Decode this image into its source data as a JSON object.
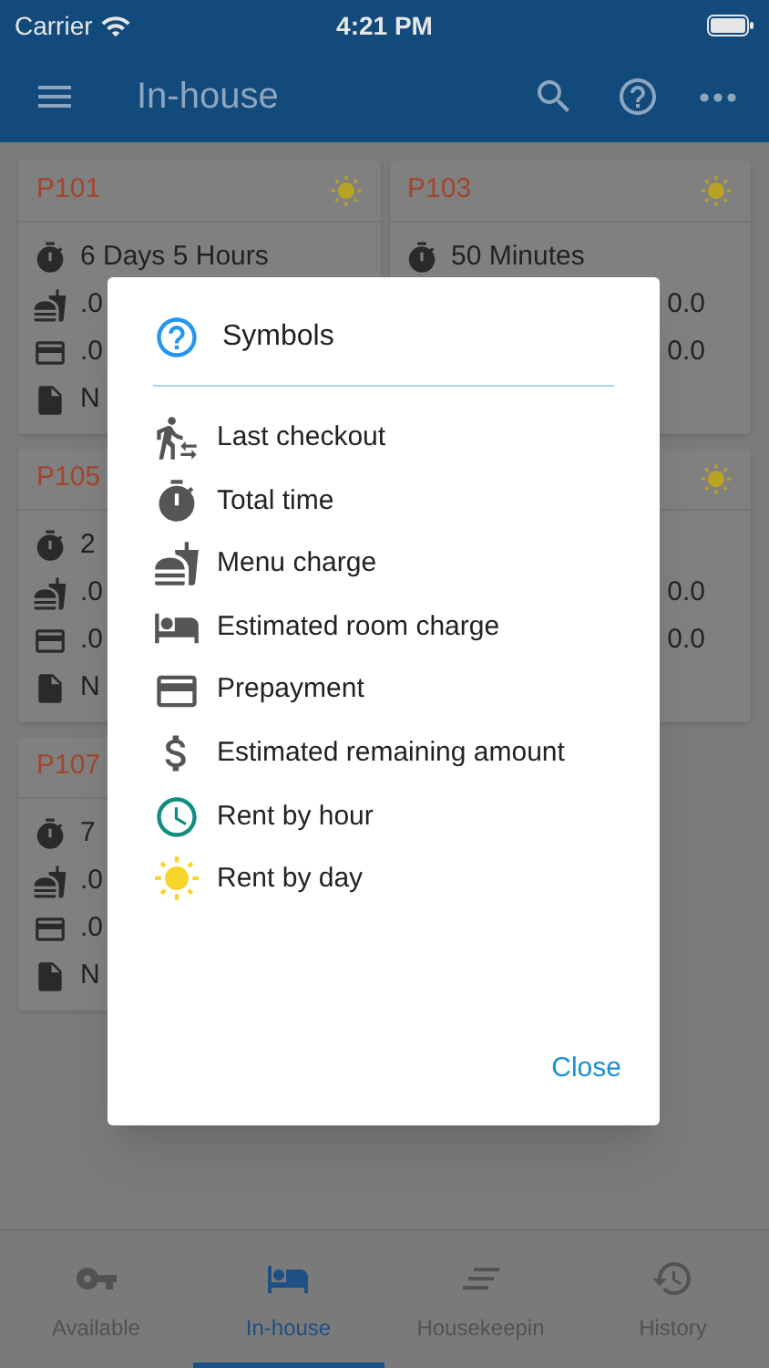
{
  "status_bar": {
    "carrier": "Carrier",
    "time": "4:21 PM"
  },
  "app_bar": {
    "title": "In-house"
  },
  "cards": [
    {
      "room": "P101",
      "rent_by_day": true,
      "rows": [
        {
          "kind": "time",
          "text": "6 Days 5 Hours"
        },
        {
          "kind": "menu",
          "text": ".0"
        },
        {
          "kind": "prepay",
          "text": ".0"
        },
        {
          "kind": "note",
          "text": "N"
        }
      ]
    },
    {
      "room": "P103",
      "rent_by_day": true,
      "rows": [
        {
          "kind": "time",
          "text": "50 Minutes"
        },
        {
          "kind": "amount",
          "text": "0.0"
        },
        {
          "kind": "amount",
          "text": "0.0"
        }
      ]
    },
    {
      "room": "P105",
      "rows": [
        {
          "kind": "time",
          "text": "2"
        },
        {
          "kind": "menu",
          "text": ".0"
        },
        {
          "kind": "prepay",
          "text": ".0"
        },
        {
          "kind": "note",
          "text": "N"
        }
      ]
    },
    {
      "rent_by_day": true,
      "rows": [
        {
          "kind": "blank"
        },
        {
          "kind": "amount",
          "text": "0.0"
        },
        {
          "kind": "amount",
          "text": "0.0"
        }
      ]
    },
    {
      "room": "P107",
      "rows": [
        {
          "kind": "time",
          "text": "7"
        },
        {
          "kind": "menu",
          "text": ".0"
        },
        {
          "kind": "prepay",
          "text": ".0"
        },
        {
          "kind": "note",
          "text": "N"
        }
      ]
    }
  ],
  "dialog": {
    "title": "Symbols",
    "items": [
      {
        "kind": "checkout",
        "label": "Last checkout"
      },
      {
        "kind": "time",
        "label": "Total time"
      },
      {
        "kind": "menu",
        "label": "Menu charge"
      },
      {
        "kind": "room",
        "label": "Estimated room charge"
      },
      {
        "kind": "prepay",
        "label": "Prepayment"
      },
      {
        "kind": "money",
        "label": "Estimated remaining amount"
      },
      {
        "kind": "hour",
        "label": "Rent by hour"
      },
      {
        "kind": "day",
        "label": "Rent by day"
      }
    ],
    "close": "Close"
  },
  "tabs": [
    {
      "kind": "key",
      "label": "Available",
      "selected": false
    },
    {
      "kind": "bed",
      "label": "In-house",
      "selected": true
    },
    {
      "kind": "lines",
      "label": "Housekeepin",
      "selected": false
    },
    {
      "kind": "history",
      "label": "History",
      "selected": false
    }
  ]
}
